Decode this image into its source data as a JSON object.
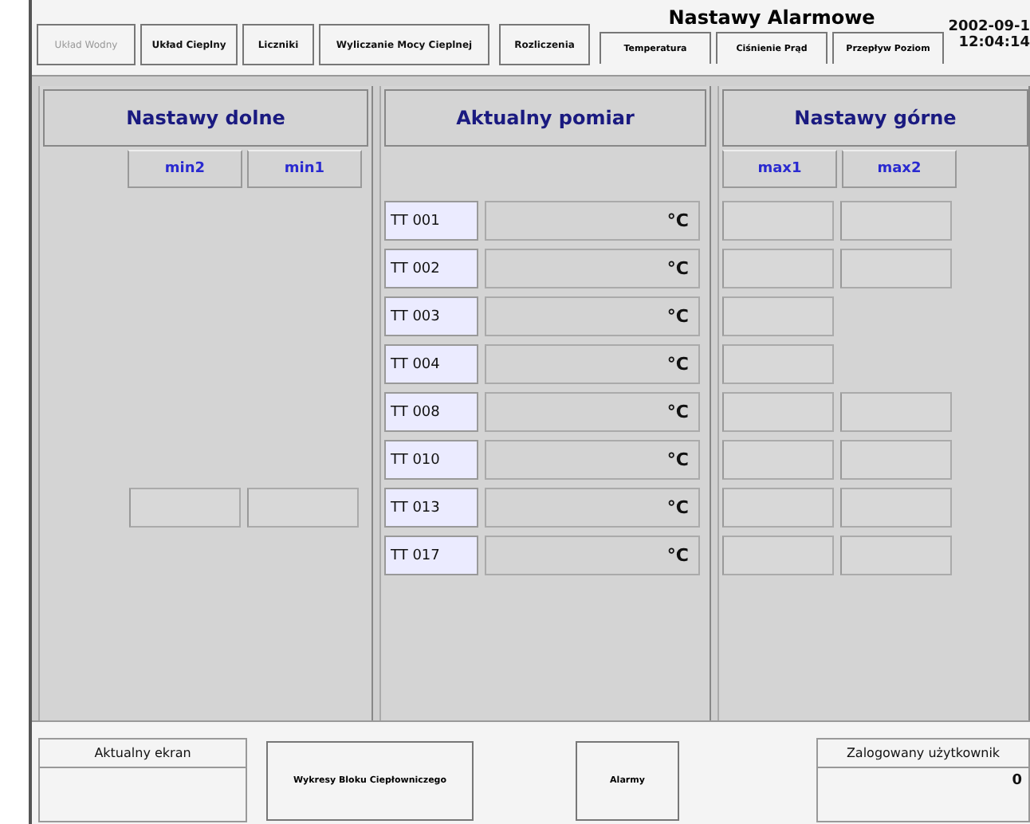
{
  "nav_buttons": [
    {
      "label": "Układ Wodny",
      "disabled": true
    },
    {
      "label": "Układ Cieplny",
      "disabled": false
    },
    {
      "label": "Liczniki",
      "disabled": false
    },
    {
      "label": "Wyliczanie Mocy Cieplnej",
      "disabled": false
    },
    {
      "label": "Rozliczenia",
      "disabled": false
    }
  ],
  "screen_title": "Nastawy Alarmowe",
  "tabs": [
    {
      "label": "Temperatura"
    },
    {
      "label": "Ciśnienie Prąd"
    },
    {
      "label": "Przepływ Poziom"
    }
  ],
  "date": "2002-09-1",
  "time": "12:04:14",
  "lower": {
    "title": "Nastawy dolne",
    "columns": [
      "min2",
      "min1"
    ]
  },
  "current": {
    "title": "Aktualny pomiar"
  },
  "upper": {
    "title": "Nastawy górne",
    "columns": [
      "max1",
      "max2"
    ]
  },
  "rows": [
    {
      "tag": "TT 001",
      "unit": "°C",
      "has_min": false,
      "has_max1": true,
      "has_max2": true
    },
    {
      "tag": "TT 002",
      "unit": "°C",
      "has_min": false,
      "has_max1": true,
      "has_max2": true
    },
    {
      "tag": "TT 003",
      "unit": "°C",
      "has_min": false,
      "has_max1": true,
      "has_max2": false
    },
    {
      "tag": "TT 004",
      "unit": "°C",
      "has_min": false,
      "has_max1": true,
      "has_max2": false
    },
    {
      "tag": "TT 008",
      "unit": "°C",
      "has_min": false,
      "has_max1": true,
      "has_max2": true
    },
    {
      "tag": "TT 010",
      "unit": "°C",
      "has_min": false,
      "has_max1": true,
      "has_max2": true
    },
    {
      "tag": "TT 013",
      "unit": "°C",
      "has_min": true,
      "has_max1": true,
      "has_max2": true
    },
    {
      "tag": "TT 017",
      "unit": "°C",
      "has_min": false,
      "has_max1": true,
      "has_max2": true
    }
  ],
  "footer": {
    "screen_label": "Aktualny ekran",
    "charts_button": "Wykresy Bloku Ciepłowniczego",
    "alarms_button": "Alarmy",
    "user_label": "Zalogowany użytkownik",
    "user_value": "0"
  }
}
